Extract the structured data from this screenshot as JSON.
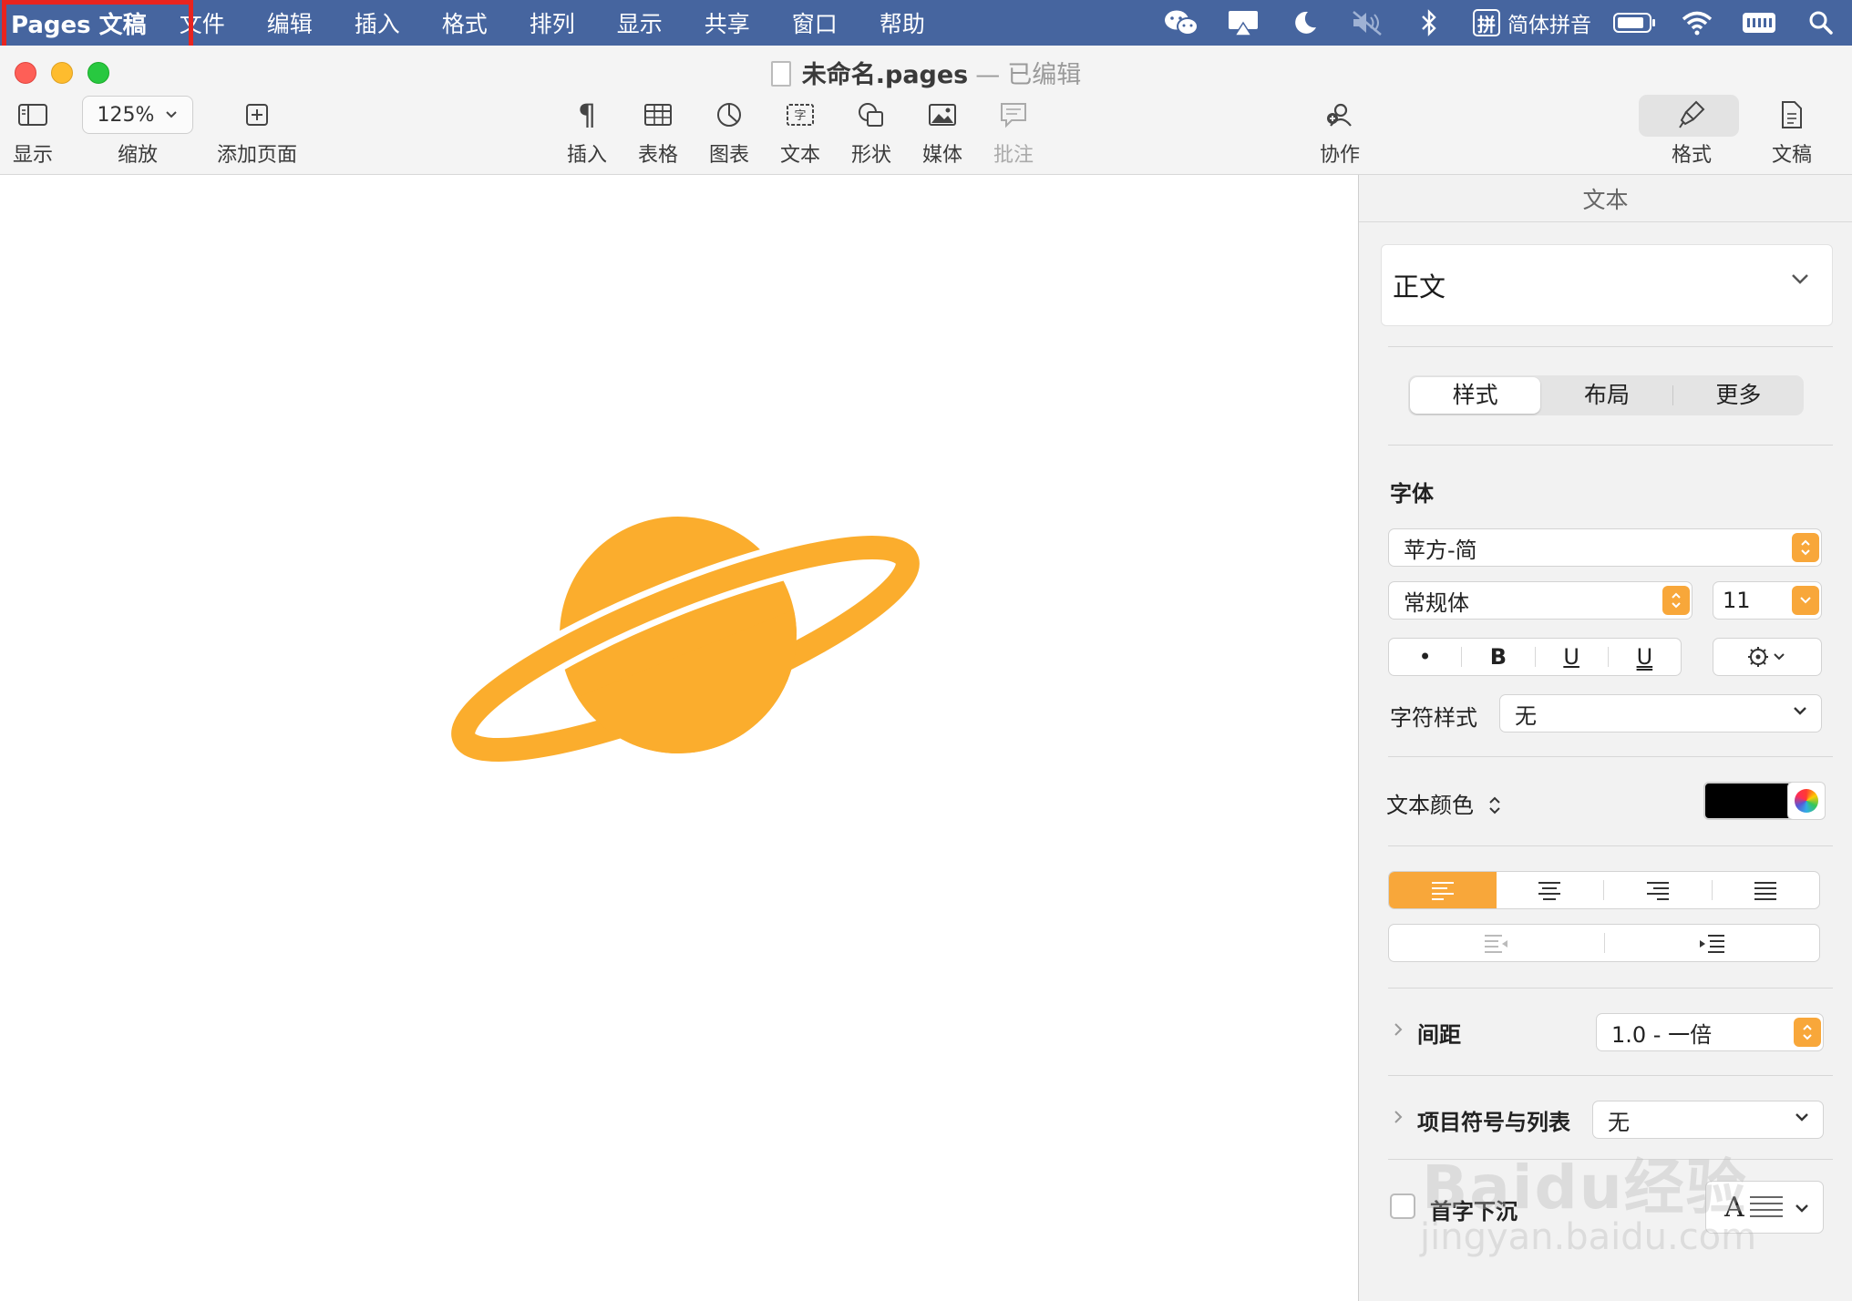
{
  "menubar": {
    "app_name": "Pages 文稿",
    "items": [
      "文件",
      "编辑",
      "插入",
      "格式",
      "排列",
      "显示",
      "共享",
      "窗口",
      "帮助"
    ],
    "input_method": "简体拼音",
    "ime_glyph": "拼",
    "bg_color": "#46659f"
  },
  "window": {
    "doc_name": "未命名.pages",
    "separator": "—",
    "status": "已编辑"
  },
  "toolbar": {
    "view_label": "显示",
    "zoom_value": "125%",
    "zoom_label": "缩放",
    "add_page_label": "添加页面",
    "insert_label": "插入",
    "table_label": "表格",
    "chart_label": "图表",
    "text_label": "文本",
    "shape_label": "形状",
    "media_label": "媒体",
    "comment_label": "批注",
    "collaborate_label": "协作",
    "format_label": "格式",
    "document_label": "文稿"
  },
  "canvas": {
    "shape_icon": "planet-ringed-icon",
    "shape_color": "#fbad2d"
  },
  "inspector": {
    "header": "文本",
    "paragraph_style": "正文",
    "tabs": [
      "样式",
      "布局",
      "更多"
    ],
    "font_section": "字体",
    "font_family": "苹方-简",
    "font_typeface": "常规体",
    "font_size": "11",
    "bullet": "•",
    "bold": "B",
    "italic": "U",
    "underline": "U",
    "char_style_label": "字符样式",
    "char_style_value": "无",
    "text_color_label": "文本颜色",
    "text_color": "#000000",
    "accent_color": "#f8a73a",
    "spacing_label": "间距",
    "spacing_value": "1.0 - 一倍",
    "bullets_label": "项目符号与列表",
    "bullets_value": "无",
    "dropcap_label": "首字下沉",
    "dropcap_glyph": "A"
  },
  "watermark": {
    "line1": "Baidu经验",
    "line2": "jingyan.baidu.com"
  }
}
